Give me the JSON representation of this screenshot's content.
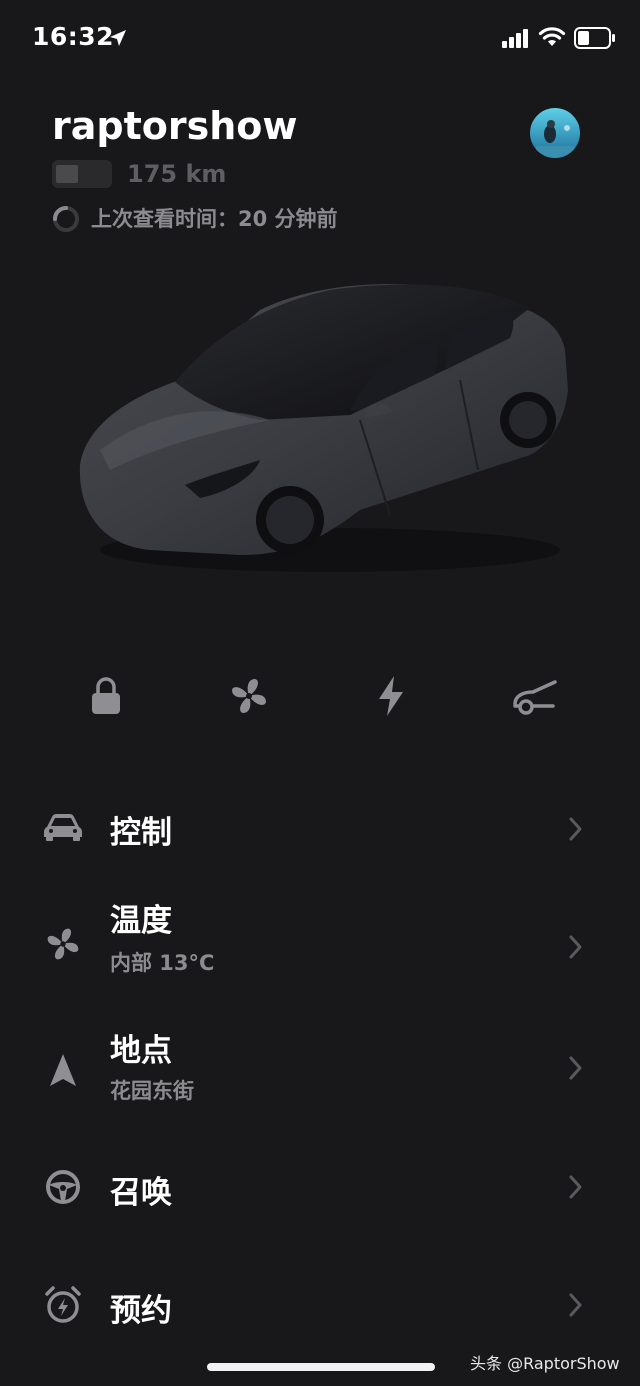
{
  "status_bar": {
    "time": "16:32"
  },
  "vehicle": {
    "name": "raptorshow",
    "range": "175 km",
    "battery_level_fraction": 0.35,
    "last_seen": "上次查看时间：20 分钟前"
  },
  "quick_actions": [
    "lock-icon",
    "fan-icon",
    "bolt-icon",
    "trunk-icon"
  ],
  "menu": {
    "controls": {
      "title": "控制"
    },
    "climate": {
      "title": "温度",
      "subtitle": "内部 13°C"
    },
    "location": {
      "title": "地点",
      "subtitle": "花园东街"
    },
    "summon": {
      "title": "召唤"
    },
    "schedule": {
      "title": "预约"
    }
  },
  "watermark": "头条 @RaptorShow",
  "colors": {
    "background": "#18181a",
    "icon": "#8f8f93",
    "secondary_text": "#8c8c90"
  }
}
